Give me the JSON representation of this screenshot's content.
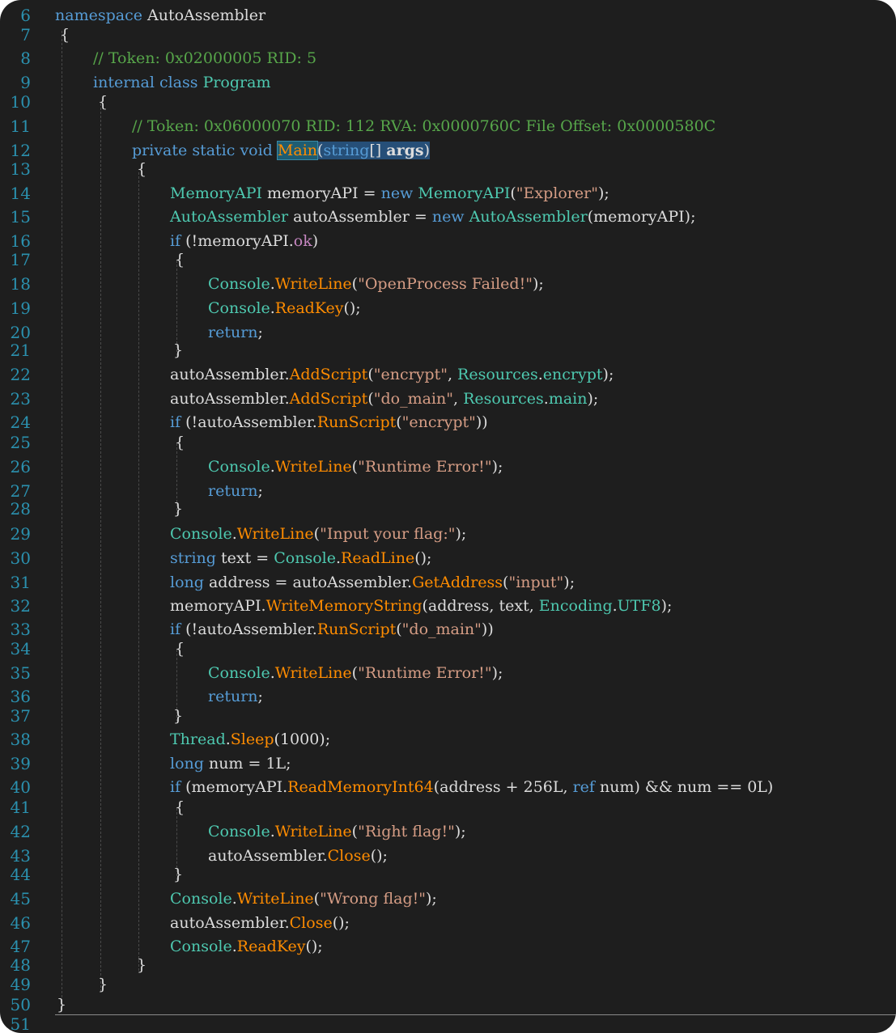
{
  "editor": {
    "colors": {
      "background": "#1e1e1e",
      "keyword": "#569cd6",
      "type": "#4ec9b0",
      "method": "#ff8c00",
      "string": "#d69d85",
      "comment": "#57a64a",
      "line_number": "#2b91af"
    },
    "lines": [
      {
        "n": "6"
      },
      {
        "n": "7"
      },
      {
        "n": "8"
      },
      {
        "n": "9"
      },
      {
        "n": "10"
      },
      {
        "n": "11"
      },
      {
        "n": "12"
      },
      {
        "n": "13"
      },
      {
        "n": "14"
      },
      {
        "n": "15"
      },
      {
        "n": "16"
      },
      {
        "n": "17"
      },
      {
        "n": "18"
      },
      {
        "n": "19"
      },
      {
        "n": "20"
      },
      {
        "n": "21"
      },
      {
        "n": "22"
      },
      {
        "n": "23"
      },
      {
        "n": "24"
      },
      {
        "n": "25"
      },
      {
        "n": "26"
      },
      {
        "n": "27"
      },
      {
        "n": "28"
      },
      {
        "n": "29"
      },
      {
        "n": "30"
      },
      {
        "n": "31"
      },
      {
        "n": "32"
      },
      {
        "n": "33"
      },
      {
        "n": "34"
      },
      {
        "n": "35"
      },
      {
        "n": "36"
      },
      {
        "n": "37"
      },
      {
        "n": "38"
      },
      {
        "n": "39"
      },
      {
        "n": "40"
      },
      {
        "n": "41"
      },
      {
        "n": "42"
      },
      {
        "n": "43"
      },
      {
        "n": "44"
      },
      {
        "n": "45"
      },
      {
        "n": "46"
      },
      {
        "n": "47"
      },
      {
        "n": "48"
      },
      {
        "n": "49"
      },
      {
        "n": "50"
      },
      {
        "n": "51"
      }
    ],
    "code": {
      "l6": [
        "namespace",
        " ",
        "AutoAssembler"
      ],
      "l7": [
        "{"
      ],
      "l8": [
        "// Token: 0x02000005 RID: 5"
      ],
      "l9": [
        "internal",
        " ",
        "class",
        " ",
        "Program"
      ],
      "l10": [
        "{"
      ],
      "l11": [
        "// Token: 0x06000070 RID: 112 RVA: 0x0000760C File Offset: 0x0000580C"
      ],
      "l12": [
        "private",
        " ",
        "static",
        " ",
        "void",
        " ",
        "Main",
        "(",
        "string",
        "[] ",
        "args",
        ")"
      ],
      "l13": [
        "{"
      ],
      "l14": [
        "MemoryAPI",
        " memoryAPI = ",
        "new",
        " ",
        "MemoryAPI",
        "(",
        "\"Explorer\"",
        ");"
      ],
      "l15": [
        "AutoAssembler",
        " autoAssembler = ",
        "new",
        " ",
        "AutoAssembler",
        "(memoryAPI);"
      ],
      "l16": [
        "if",
        " (!memoryAPI.",
        "ok",
        ")"
      ],
      "l17": [
        "{"
      ],
      "l18": [
        "Console",
        ".",
        "WriteLine",
        "(",
        "\"OpenProcess Failed!\"",
        ");"
      ],
      "l19": [
        "Console",
        ".",
        "ReadKey",
        "();"
      ],
      "l20": [
        "return",
        ";"
      ],
      "l21": [
        "}"
      ],
      "l22": [
        "autoAssembler.",
        "AddScript",
        "(",
        "\"encrypt\"",
        ", ",
        "Resources",
        ".",
        "encrypt",
        ");"
      ],
      "l23": [
        "autoAssembler.",
        "AddScript",
        "(",
        "\"do_main\"",
        ", ",
        "Resources",
        ".",
        "main",
        ");"
      ],
      "l24": [
        "if",
        " (!autoAssembler.",
        "RunScript",
        "(",
        "\"encrypt\"",
        "))"
      ],
      "l25": [
        "{"
      ],
      "l26": [
        "Console",
        ".",
        "WriteLine",
        "(",
        "\"Runtime Error!\"",
        ");"
      ],
      "l27": [
        "return",
        ";"
      ],
      "l28": [
        "}"
      ],
      "l29": [
        "Console",
        ".",
        "WriteLine",
        "(",
        "\"Input your flag:\"",
        ");"
      ],
      "l30": [
        "string",
        " text = ",
        "Console",
        ".",
        "ReadLine",
        "();"
      ],
      "l31": [
        "long",
        " address = autoAssembler.",
        "GetAddress",
        "(",
        "\"input\"",
        ");"
      ],
      "l32": [
        "memoryAPI.",
        "WriteMemoryString",
        "(address, text, ",
        "Encoding",
        ".",
        "UTF8",
        ");"
      ],
      "l33": [
        "if",
        " (!autoAssembler.",
        "RunScript",
        "(",
        "\"do_main\"",
        "))"
      ],
      "l34": [
        "{"
      ],
      "l35": [
        "Console",
        ".",
        "WriteLine",
        "(",
        "\"Runtime Error!\"",
        ");"
      ],
      "l36": [
        "return",
        ";"
      ],
      "l37": [
        "}"
      ],
      "l38": [
        "Thread",
        ".",
        "Sleep",
        "(1000);"
      ],
      "l39": [
        "long",
        " num = 1L;"
      ],
      "l40": [
        "if",
        " (memoryAPI.",
        "ReadMemoryInt64",
        "(address + 256L, ",
        "ref",
        " num) && num == 0L)"
      ],
      "l41": [
        "{"
      ],
      "l42": [
        "Console",
        ".",
        "WriteLine",
        "(",
        "\"Right flag!\"",
        ");"
      ],
      "l43": [
        "autoAssembler.",
        "Close",
        "();"
      ],
      "l44": [
        "}"
      ],
      "l45": [
        "Console",
        ".",
        "WriteLine",
        "(",
        "\"Wrong flag!\"",
        ");"
      ],
      "l46": [
        "autoAssembler.",
        "Close",
        "();"
      ],
      "l47": [
        "Console",
        ".",
        "ReadKey",
        "();"
      ],
      "l48": [
        "}"
      ],
      "l49": [
        "}"
      ],
      "l50": [
        "}"
      ],
      "l51": [
        ""
      ]
    }
  }
}
